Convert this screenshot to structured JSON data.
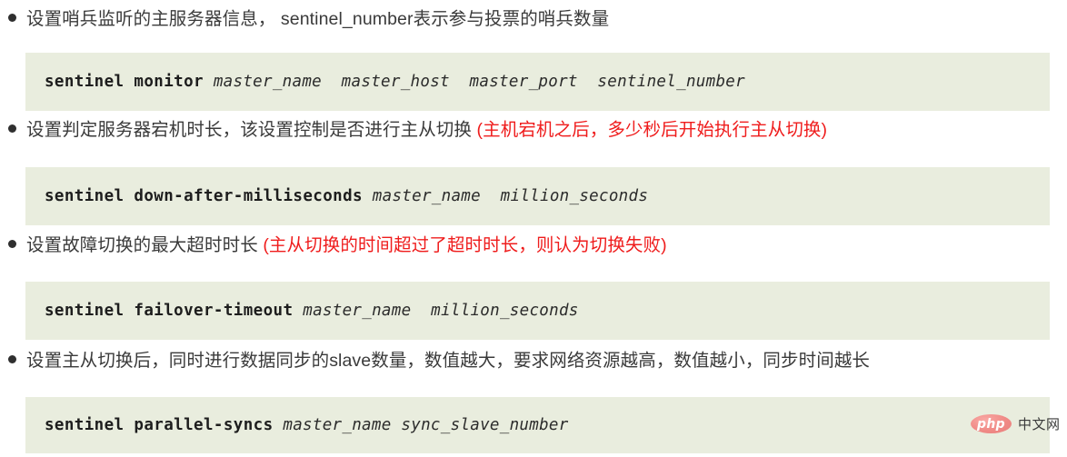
{
  "document": {
    "background_color": "#ffffff",
    "code_background_color": "#e9edde",
    "highlight_color": "#ef1c1c",
    "text_color": "#3a3a3a"
  },
  "items": [
    {
      "bullet_prefix": "设置哨兵监听的主服务器信息，",
      "bullet_plain": " sentinel_number表示参与投票的哨兵数量",
      "bullet_highlight": "",
      "code_keyword": "sentinel monitor",
      "code_args": " master_name  master_host  master_port  sentinel_number"
    },
    {
      "bullet_prefix": "设置判定服务器宕机时长，该设置控制是否进行主从切换",
      "bullet_plain": "",
      "bullet_highlight": " (主机宕机之后，多少秒后开始执行主从切换)",
      "code_keyword": "sentinel down-after-milliseconds",
      "code_args": " master_name  million_seconds"
    },
    {
      "bullet_prefix": "设置故障切换的最大超时时长",
      "bullet_plain": "",
      "bullet_highlight": " (主从切换的时间超过了超时时长，则认为切换失败)",
      "code_keyword": "sentinel failover-timeout",
      "code_args": " master_name  million_seconds"
    },
    {
      "bullet_prefix": "设置主从切换后，同时进行数据同步的slave数量，数值越大，要求网络资源越高，数值越小，同步时间越长",
      "bullet_plain": "",
      "bullet_highlight": "",
      "code_keyword": "sentinel parallel-syncs",
      "code_args": " master_name sync_slave_number"
    }
  ],
  "watermark": {
    "logo_text": "php",
    "label": "中文网"
  }
}
